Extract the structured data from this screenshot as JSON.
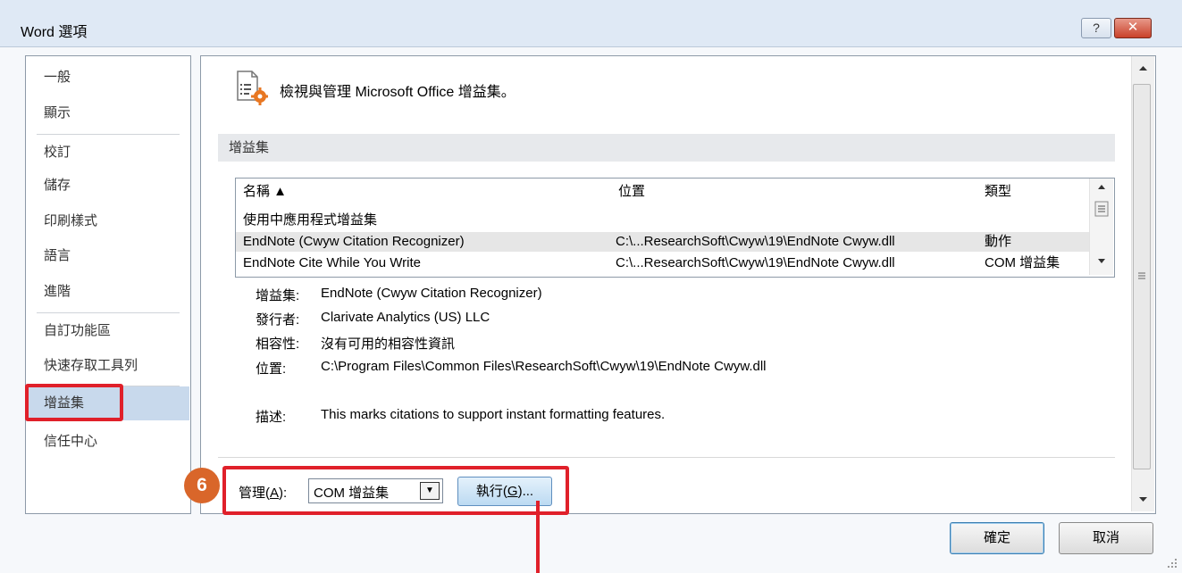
{
  "window": {
    "title": "Word 選項",
    "help_label": "?",
    "close_label": "✕"
  },
  "sidebar": {
    "items": [
      {
        "label": "一般"
      },
      {
        "label": "顯示"
      },
      {
        "label": "校訂"
      },
      {
        "label": "儲存"
      },
      {
        "label": "印刷樣式"
      },
      {
        "label": "語言"
      },
      {
        "label": "進階"
      },
      {
        "label": "自訂功能區"
      },
      {
        "label": "快速存取工具列"
      },
      {
        "label": "增益集"
      },
      {
        "label": "信任中心"
      }
    ],
    "selected": "增益集"
  },
  "main": {
    "heading": "檢視與管理 Microsoft Office 增益集。",
    "section_title": "增益集",
    "table": {
      "columns": [
        "名稱 ▲",
        "位置",
        "類型"
      ],
      "group_label": "使用中應用程式增益集",
      "rows": [
        {
          "name": "EndNote (Cwyw Citation Recognizer)",
          "location": "C:\\...ResearchSoft\\Cwyw\\19\\EndNote Cwyw.dll",
          "type": "動作"
        },
        {
          "name": "EndNote Cite While You Write",
          "location": "C:\\...ResearchSoft\\Cwyw\\19\\EndNote Cwyw.dll",
          "type": "COM 增益集"
        }
      ]
    },
    "details": {
      "addin_label": "增益集:",
      "addin_value": "EndNote (Cwyw Citation Recognizer)",
      "publisher_label": "發行者:",
      "publisher_value": "Clarivate Analytics (US) LLC",
      "compat_label": "相容性:",
      "compat_value": "沒有可用的相容性資訊",
      "location_label": "位置:",
      "location_value": "C:\\Program Files\\Common Files\\ResearchSoft\\Cwyw\\19\\EndNote Cwyw.dll",
      "desc_label": "描述:",
      "desc_value": "This marks citations to support instant formatting features."
    },
    "manage": {
      "label_pre": "管理(",
      "label_key": "A",
      "label_post": "):",
      "selected": "COM 增益集",
      "go_pre": "執行(",
      "go_key": "G",
      "go_post": ")..."
    }
  },
  "annotation": {
    "step_number": "6",
    "highlight_color": "#e0202a",
    "badge_color": "#d9662a"
  },
  "footer": {
    "ok_label": "確定",
    "cancel_label": "取消"
  }
}
